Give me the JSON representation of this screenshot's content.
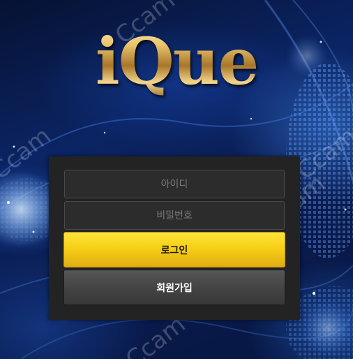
{
  "brand": {
    "logo_text": "iQue"
  },
  "watermark": {
    "text": "Ccam"
  },
  "login_form": {
    "username_placeholder": "아이디",
    "password_placeholder": "비밀번호",
    "login_label": "로그인",
    "signup_label": "회원가입"
  },
  "colors": {
    "login_button": "#f6cf16",
    "signup_button": "#444444",
    "panel_background": "#232323",
    "page_background": "#0b2463",
    "logo_gold": "#e9c46e"
  }
}
